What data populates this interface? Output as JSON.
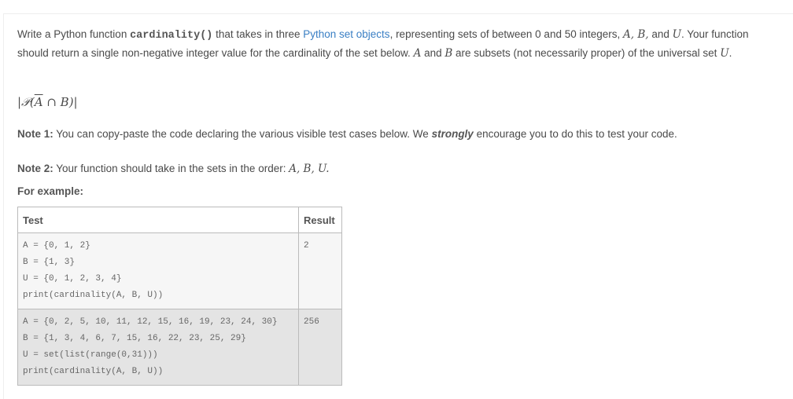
{
  "intro": {
    "p1": "Write a Python function ",
    "fn": "cardinality()",
    "p2": " that takes in three ",
    "link": "Python set objects",
    "p3": ", representing sets of between 0 and 50 integers, ",
    "sets": "A, B,",
    "p4": " and ",
    "u": "U",
    "p5": ". Your function should return a single non-negative integer value for the cardinality of the set below. ",
    "a": "A",
    "p6": " and ",
    "b": "B",
    "p7": " are subsets (not necessarily proper) of the universal set ",
    "u2": "U",
    "p8": "."
  },
  "formula": {
    "pre": "|𝒫(",
    "abar": "A",
    "post": " ∩ B)|"
  },
  "note1": {
    "label": "Note 1:",
    "pre": " You can copy-paste the code declaring the various visible test cases below. We ",
    "em": "strongly",
    "post": " encourage you to do this to test your code."
  },
  "note2": {
    "label": "Note 2:",
    "text": " Your function should take in the sets in the order: ",
    "sets": "A, B, U."
  },
  "example_label": "For example:",
  "table": {
    "headers": [
      "Test",
      "Result"
    ],
    "rows": [
      {
        "test": "A = {0, 1, 2}\nB = {1, 3}\nU = {0, 1, 2, 3, 4}\nprint(cardinality(A, B, U))",
        "result": "2"
      },
      {
        "test": "A = {0, 2, 5, 10, 11, 12, 15, 16, 19, 23, 24, 30}\nB = {1, 3, 4, 6, 7, 15, 16, 22, 23, 25, 29}\nU = set(list(range(0,31)))\nprint(cardinality(A, B, U))",
        "result": "256"
      }
    ]
  }
}
